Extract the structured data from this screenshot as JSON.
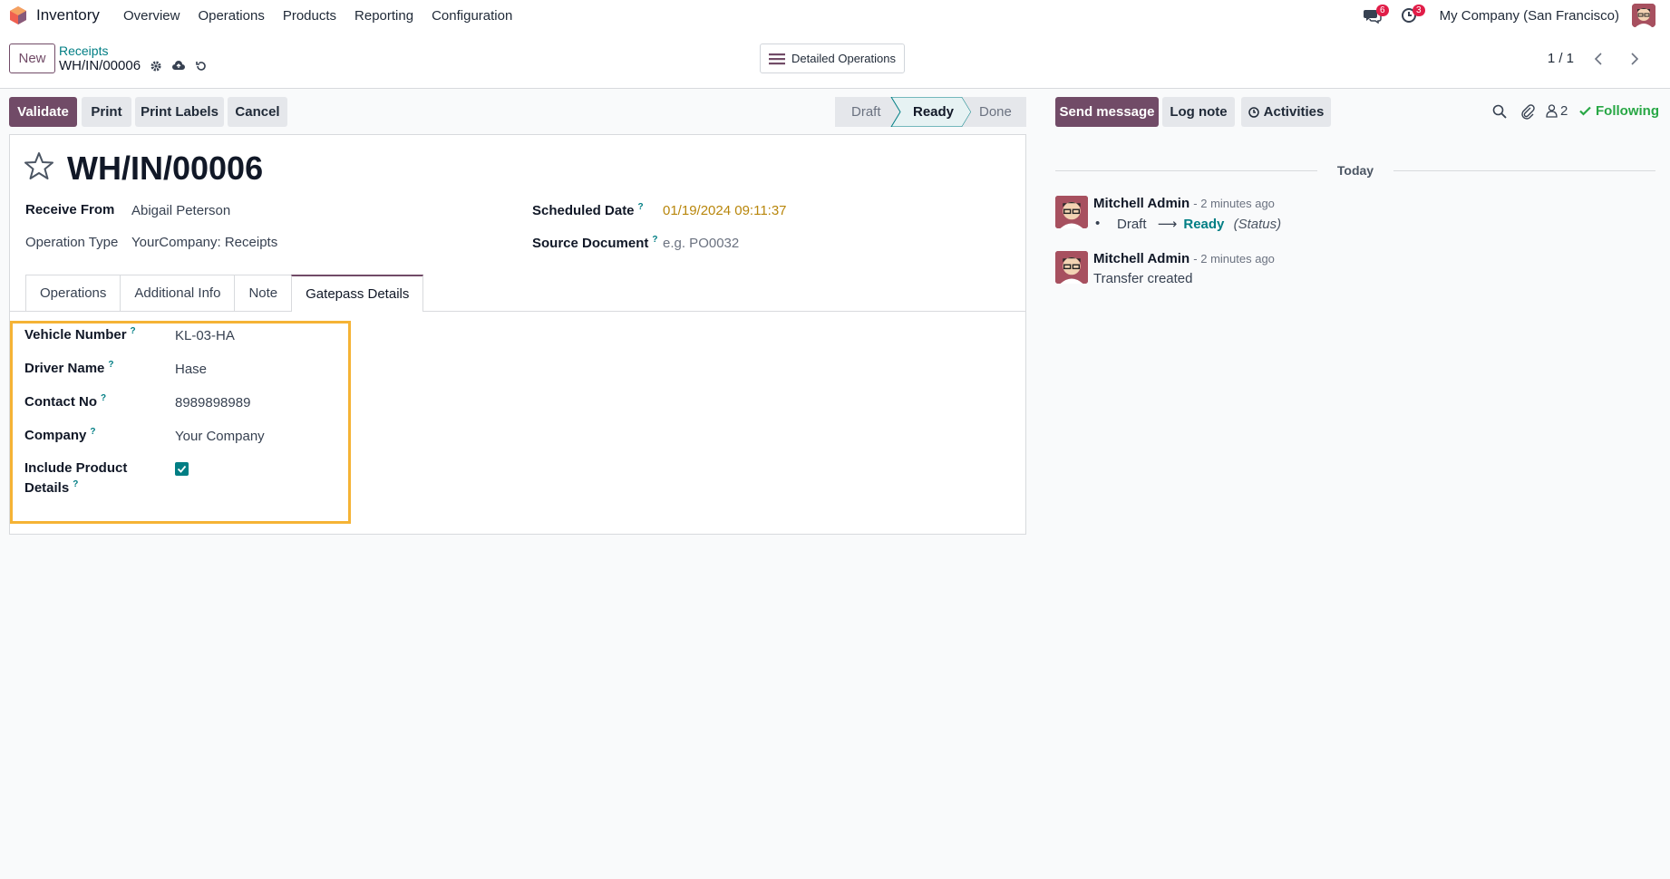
{
  "nav": {
    "app_name": "Inventory",
    "menu": [
      "Overview",
      "Operations",
      "Products",
      "Reporting",
      "Configuration"
    ],
    "messages_badge": "6",
    "activities_badge": "3",
    "company": "My Company (San Francisco)"
  },
  "control": {
    "new_label": "New",
    "breadcrumb_parent": "Receipts",
    "breadcrumb_current": "WH/IN/00006",
    "detailed_ops_label": "Detailed Operations",
    "pager": "1 / 1"
  },
  "actions": {
    "validate": "Validate",
    "print": "Print",
    "print_labels": "Print Labels",
    "cancel": "Cancel"
  },
  "status": {
    "steps": [
      "Draft",
      "Ready",
      "Done"
    ],
    "current": "Ready"
  },
  "form": {
    "title": "WH/IN/00006",
    "receive_from_label": "Receive From",
    "receive_from": "Abigail Peterson",
    "operation_type_label": "Operation Type",
    "operation_type": "YourCompany: Receipts",
    "scheduled_date_label": "Scheduled Date",
    "scheduled_date": "01/19/2024 09:11:37",
    "source_document_label": "Source Document",
    "source_document_placeholder": "e.g. PO0032",
    "help_mark": "?"
  },
  "tabs": [
    "Operations",
    "Additional Info",
    "Note",
    "Gatepass Details"
  ],
  "gatepass": {
    "vehicle_number_label": "Vehicle Number",
    "vehicle_number": "KL-03-HA",
    "driver_name_label": "Driver Name",
    "driver_name": "Hase",
    "contact_no_label": "Contact No",
    "contact_no": "8989898989",
    "company_label": "Company",
    "company": "Your Company",
    "include_product_label_1": "Include Product",
    "include_product_label_2": "Details",
    "include_product_checked": true
  },
  "chatter": {
    "send_message": "Send message",
    "log_note": "Log note",
    "activities": "Activities",
    "followers_count": "2",
    "following": "Following",
    "date_separator": "Today",
    "messages": [
      {
        "author": "Mitchell Admin",
        "time": "- 2 minutes ago",
        "from": "Draft",
        "to": "Ready",
        "field": "(Status)"
      },
      {
        "author": "Mitchell Admin",
        "time": "- 2 minutes ago",
        "body": "Transfer created"
      }
    ]
  },
  "colors": {
    "primary": "#714b67",
    "teal": "#017e84",
    "highlight": "#f5b335",
    "date_warning": "#b8860b",
    "following": "#28a745"
  }
}
